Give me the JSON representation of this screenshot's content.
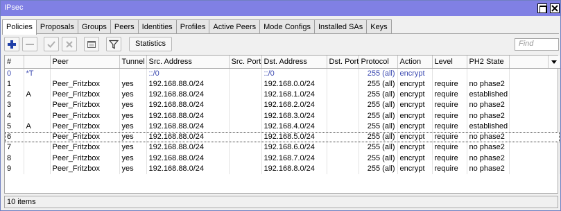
{
  "window": {
    "title": "IPsec"
  },
  "tabs": [
    {
      "label": "Policies",
      "active": true
    },
    {
      "label": "Proposals"
    },
    {
      "label": "Groups"
    },
    {
      "label": "Peers"
    },
    {
      "label": "Identities"
    },
    {
      "label": "Profiles"
    },
    {
      "label": "Active Peers"
    },
    {
      "label": "Mode Configs"
    },
    {
      "label": "Installed SAs"
    },
    {
      "label": "Keys"
    }
  ],
  "toolbar": {
    "add_icon": "plus-icon",
    "remove_icon": "minus-icon",
    "enable_icon": "check-icon",
    "disable_icon": "x-icon",
    "comment_icon": "comment-icon",
    "filter_icon": "filter-icon",
    "statistics_label": "Statistics",
    "find_placeholder": "Find"
  },
  "table": {
    "columns": [
      "#",
      "",
      "Peer",
      "Tunnel",
      "Src. Address",
      "Src. Port",
      "Dst. Address",
      "Dst. Port",
      "Protocol",
      "Action",
      "Level",
      "PH2 State"
    ],
    "rows": [
      {
        "num": "0",
        "flags": "*T",
        "peer": "",
        "tunnel": "",
        "src": "::/0",
        "src_port": "",
        "dst": "::/0",
        "dst_port": "",
        "protocol": "255 (all)",
        "action": "encrypt",
        "level": "",
        "ph2": ""
      },
      {
        "num": "1",
        "flags": "",
        "peer": "Peer_Fritzbox",
        "tunnel": "yes",
        "src": "192.168.88.0/24",
        "src_port": "",
        "dst": "192.168.0.0/24",
        "dst_port": "",
        "protocol": "255 (all)",
        "action": "encrypt",
        "level": "require",
        "ph2": "no phase2"
      },
      {
        "num": "2",
        "flags": "A",
        "peer": "Peer_Fritzbox",
        "tunnel": "yes",
        "src": "192.168.88.0/24",
        "src_port": "",
        "dst": "192.168.1.0/24",
        "dst_port": "",
        "protocol": "255 (all)",
        "action": "encrypt",
        "level": "require",
        "ph2": "established"
      },
      {
        "num": "3",
        "flags": "",
        "peer": "Peer_Fritzbox",
        "tunnel": "yes",
        "src": "192.168.88.0/24",
        "src_port": "",
        "dst": "192.168.2.0/24",
        "dst_port": "",
        "protocol": "255 (all)",
        "action": "encrypt",
        "level": "require",
        "ph2": "no phase2"
      },
      {
        "num": "4",
        "flags": "",
        "peer": "Peer_Fritzbox",
        "tunnel": "yes",
        "src": "192.168.88.0/24",
        "src_port": "",
        "dst": "192.168.3.0/24",
        "dst_port": "",
        "protocol": "255 (all)",
        "action": "encrypt",
        "level": "require",
        "ph2": "no phase2"
      },
      {
        "num": "5",
        "flags": "A",
        "peer": "Peer_Fritzbox",
        "tunnel": "yes",
        "src": "192.168.88.0/24",
        "src_port": "",
        "dst": "192.168.4.0/24",
        "dst_port": "",
        "protocol": "255 (all)",
        "action": "encrypt",
        "level": "require",
        "ph2": "established"
      },
      {
        "num": "6",
        "flags": "",
        "peer": "Peer_Fritzbox",
        "tunnel": "yes",
        "src": "192.168.88.0/24",
        "src_port": "",
        "dst": "192.168.5.0/24",
        "dst_port": "",
        "protocol": "255 (all)",
        "action": "encrypt",
        "level": "require",
        "ph2": "no phase2"
      },
      {
        "num": "7",
        "flags": "",
        "peer": "Peer_Fritzbox",
        "tunnel": "yes",
        "src": "192.168.88.0/24",
        "src_port": "",
        "dst": "192.168.6.0/24",
        "dst_port": "",
        "protocol": "255 (all)",
        "action": "encrypt",
        "level": "require",
        "ph2": "no phase2"
      },
      {
        "num": "8",
        "flags": "",
        "peer": "Peer_Fritzbox",
        "tunnel": "yes",
        "src": "192.168.88.0/24",
        "src_port": "",
        "dst": "192.168.7.0/24",
        "dst_port": "",
        "protocol": "255 (all)",
        "action": "encrypt",
        "level": "require",
        "ph2": "no phase2"
      },
      {
        "num": "9",
        "flags": "",
        "peer": "Peer_Fritzbox",
        "tunnel": "yes",
        "src": "192.168.88.0/24",
        "src_port": "",
        "dst": "192.168.8.0/24",
        "dst_port": "",
        "protocol": "255 (all)",
        "action": "encrypt",
        "level": "require",
        "ph2": "no phase2"
      }
    ],
    "selected_row": 6
  },
  "status": {
    "items_text": "10 items"
  },
  "colors": {
    "titlebar": "#8080e4",
    "dynamic_text": "#3b49b0",
    "add_icon": "#1f3fa8"
  }
}
